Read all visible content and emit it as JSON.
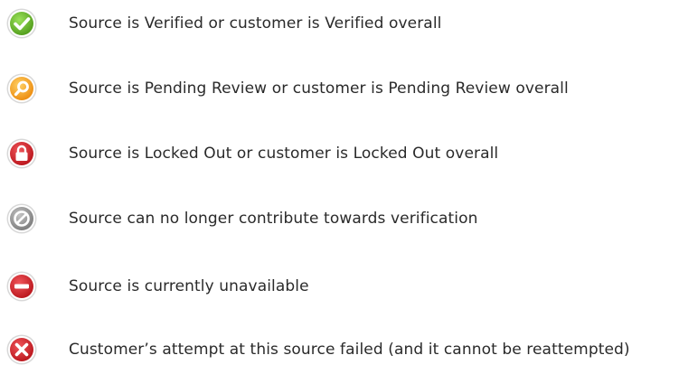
{
  "legend": {
    "items": [
      {
        "icon": "check-icon",
        "color": "#6dbb2c",
        "text": "Source is Verified or customer is Verified overall"
      },
      {
        "icon": "magnifier-icon",
        "color": "#f5a21e",
        "text": "Source is Pending Review or customer is Pending Review overall"
      },
      {
        "icon": "lock-icon",
        "color": "#d8262c",
        "text": "Source is Locked Out or customer is Locked Out overall"
      },
      {
        "icon": "prohibited-icon",
        "color": "#9a9a9a",
        "text": "Source can no longer contribute towards verification"
      },
      {
        "icon": "minus-icon",
        "color": "#d8262c",
        "text": "Source is currently unavailable"
      },
      {
        "icon": "x-icon",
        "color": "#d8262c",
        "text": "Customer’s attempt at this source failed (and it cannot be reattempted)"
      }
    ]
  }
}
